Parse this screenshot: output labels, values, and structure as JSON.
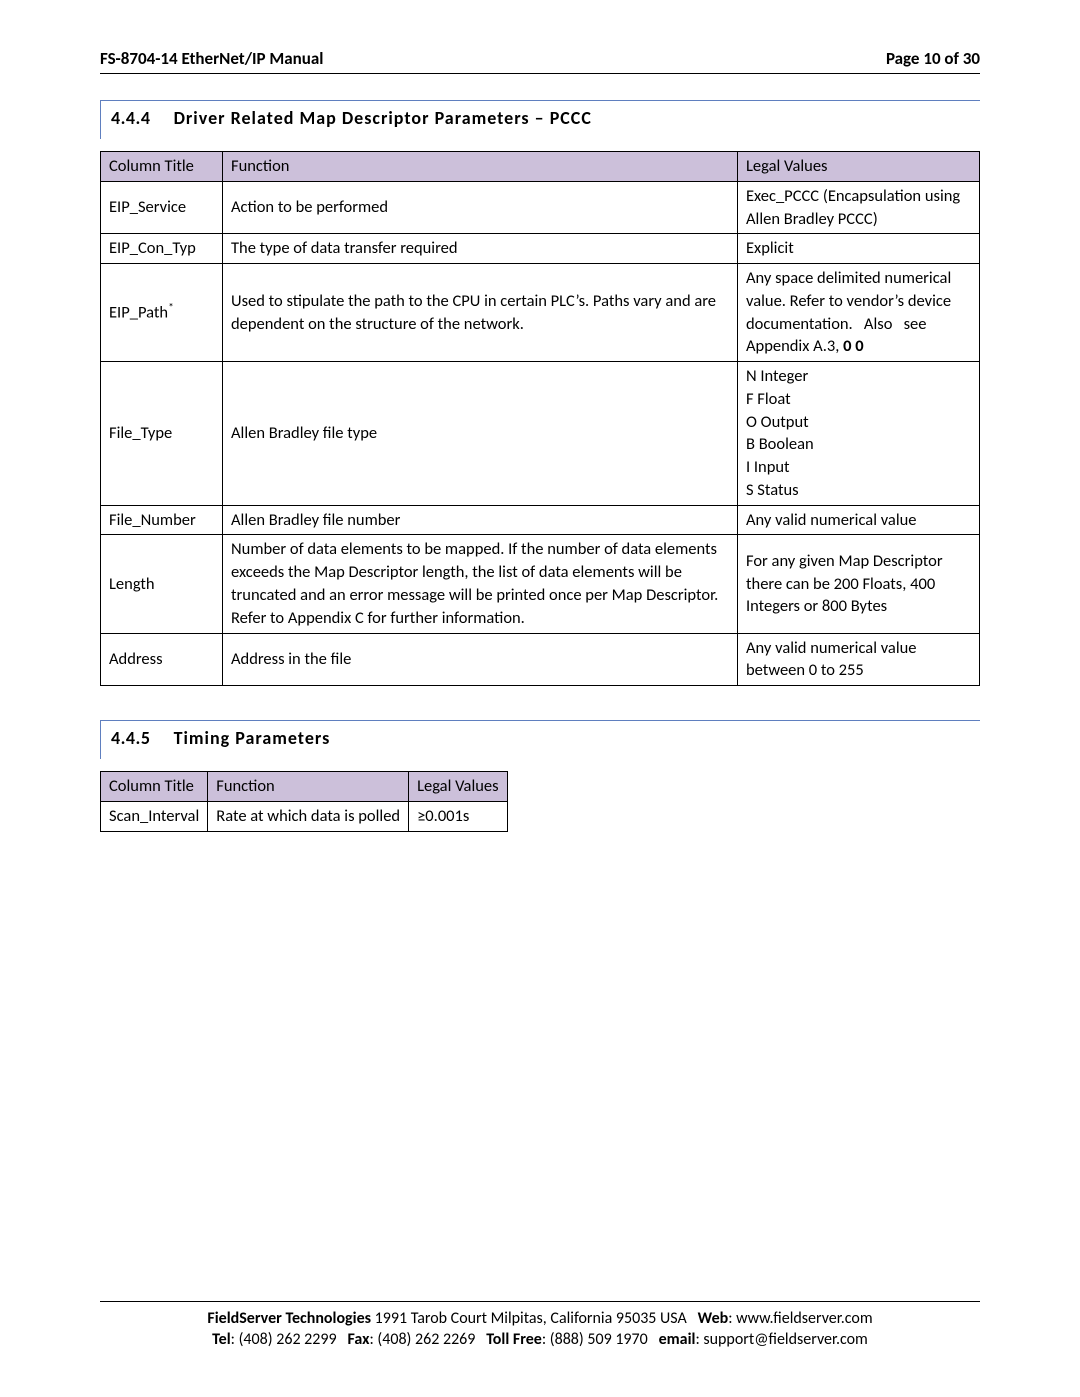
{
  "header": {
    "title": "FS-8704-14 EtherNet/IP Manual",
    "page_label": "Page 10 of 30"
  },
  "section_444": {
    "number": "4.4.4",
    "title": "Driver Related Map Descriptor Parameters – PCCC",
    "headers": {
      "c1": "Column Title",
      "c2": "Function",
      "c3": "Legal Values"
    },
    "rows": [
      {
        "c1": "EIP_Service",
        "c2": "Action to be performed",
        "c3": "Exec_PCCC (Encapsulation using Allen Bradley PCCC)"
      },
      {
        "c1": "EIP_Con_Typ",
        "c2": "The type of data transfer required",
        "c3": "Explicit"
      },
      {
        "c1_html": "EIP_Path<sup>*</sup>",
        "c2_justify": "Used to stipulate the path to the CPU in certain PLC’s.  Paths vary and are dependent on the structure of the network.",
        "c3_html_justify": "Any space delimited numerical value.  Refer to vendor’s device documentation.&nbsp;&nbsp;&nbsp;Also&nbsp;&nbsp;&nbsp;see Appendix A.3, <b>0 0</b>"
      },
      {
        "c1": "File_Type",
        "c2": "Allen Bradley file type",
        "c3_html": "N Integer<br>F Float<br>O Output<br>B Boolean<br>I Input<br>S Status"
      },
      {
        "c1": "File_Number",
        "c2": "Allen Bradley file number",
        "c3": "Any valid numerical value"
      },
      {
        "c1": "Length",
        "c2_justify": "Number of data elements to be mapped.  If the number of data elements exceeds the Map Descriptor length, the list of data elements will be truncated and an error message will be printed once per Map Descriptor.  Refer to Appendix C for further information.",
        "c3_justify": "For any given Map Descriptor there can be 200 Floats, 400 Integers or 800 Bytes"
      },
      {
        "c1": "Address",
        "c2": "Address in the file",
        "c3_justify": "Any valid numerical value between 0 to 255"
      }
    ]
  },
  "section_445": {
    "number": "4.4.5",
    "title": "Timing Parameters",
    "headers": {
      "c1": "Column Title",
      "c2": "Function",
      "c3": "Legal Values"
    },
    "rows": [
      {
        "c1": "Scan_Interval",
        "c2": "Rate at which data is polled",
        "c3": "≥0.001s"
      }
    ]
  },
  "footer": {
    "line1_html": "<b>FieldServer Technologies</b> 1991 Tarob Court Milpitas, California 95035 USA&nbsp;&nbsp;&nbsp;<b>Web</b>: www.fieldserver.com",
    "line2_html": "<b>Tel</b>: (408) 262 2299&nbsp;&nbsp;&nbsp;<b>Fax</b>: (408) 262 2269&nbsp;&nbsp;&nbsp;<b>Toll Free</b>: (888) 509 1970&nbsp;&nbsp;&nbsp;<b>email</b>: support@fieldserver.com"
  }
}
